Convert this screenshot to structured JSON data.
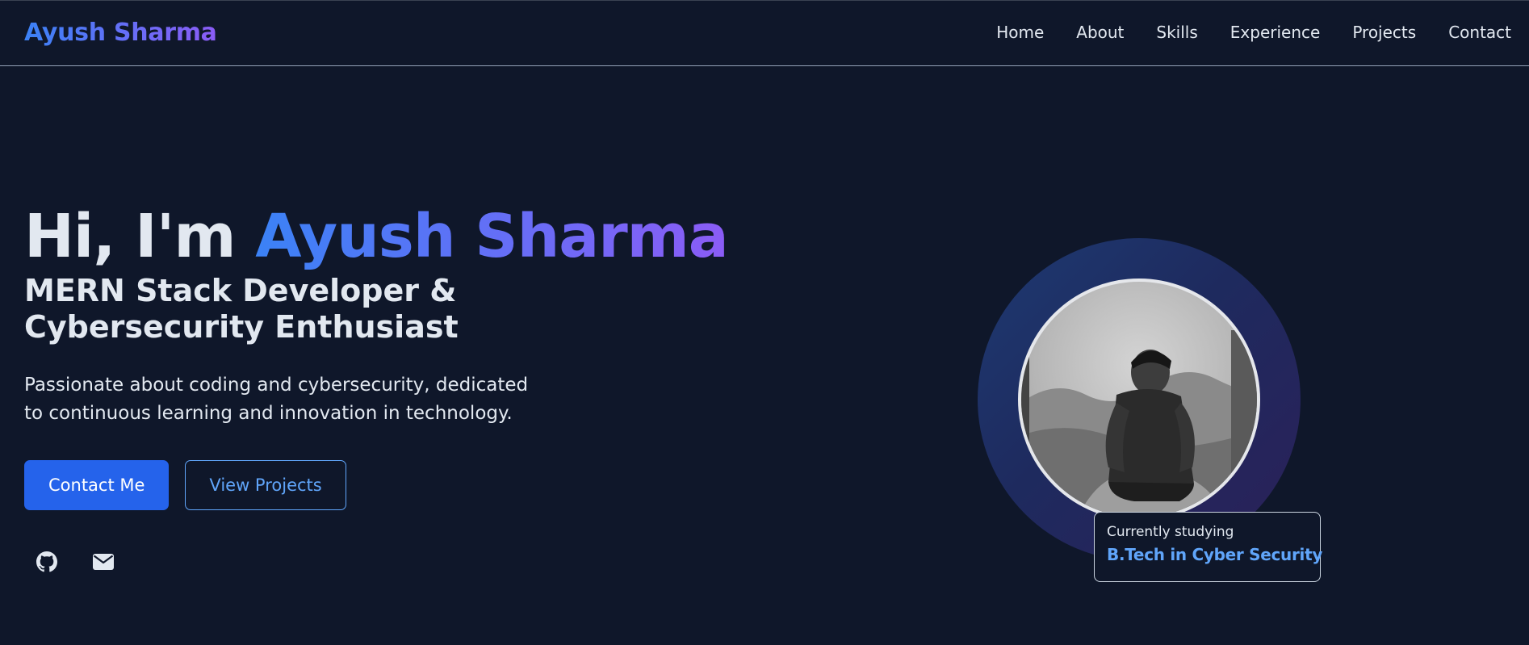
{
  "header": {
    "brand": "Ayush Sharma",
    "nav": [
      "Home",
      "About",
      "Skills",
      "Experience",
      "Projects",
      "Contact"
    ]
  },
  "hero": {
    "greeting": "Hi, I'm ",
    "name": "Ayush Sharma",
    "subtitle": "MERN Stack Developer & Cybersecurity Enthusiast",
    "description": "Passionate about coding and cybersecurity, dedicated to continuous learning and innovation in technology.",
    "primary_button": "Contact Me",
    "secondary_button": "View Projects",
    "socials": [
      "github-icon",
      "mail-icon"
    ]
  },
  "study_card": {
    "label": "Currently studying",
    "value": "B.Tech in Cyber Security"
  },
  "colors": {
    "background": "#0f172a",
    "accent_blue": "#3b82f6",
    "accent_purple": "#8b5cf6",
    "button_primary": "#2563eb",
    "link_blue": "#60a5fa"
  }
}
